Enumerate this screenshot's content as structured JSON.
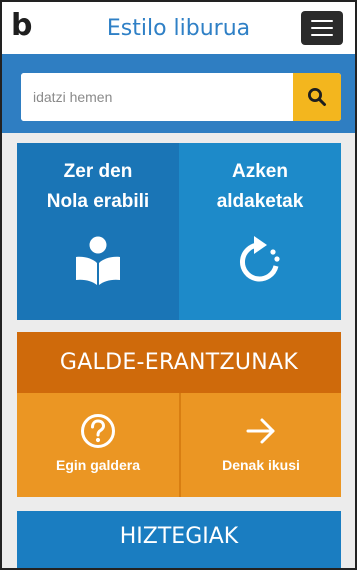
{
  "header": {
    "logo_text": "b",
    "title": "Estilo liburua",
    "menu_icon": "hamburger-icon"
  },
  "search": {
    "placeholder": "idatzi hemen",
    "value": "",
    "button_icon": "search-icon"
  },
  "guide_tiles": [
    {
      "line1": "Zer den",
      "line2": "Nola erabili",
      "icon": "reader-book-icon"
    },
    {
      "line1": "Azken",
      "line2": "aldaketak",
      "icon": "refresh-icon"
    }
  ],
  "faq": {
    "title": "GALDE-ERANTZUNAK",
    "items": [
      {
        "label": "Egin galdera",
        "icon": "question-circle-icon"
      },
      {
        "label": "Denak ikusi",
        "icon": "arrow-right-icon"
      }
    ]
  },
  "dictionaries": {
    "title": "HIZTEGIAK"
  },
  "colors": {
    "brand_blue": "#2f7ec2",
    "title_blue": "#2f80c6",
    "tile_dark_blue": "#1a75b6",
    "tile_light_blue": "#1d8ac9",
    "faq_header": "#cf6a0b",
    "faq_tile": "#eb9623",
    "search_button": "#f3b61e",
    "menu_button": "#2b2b2b"
  }
}
